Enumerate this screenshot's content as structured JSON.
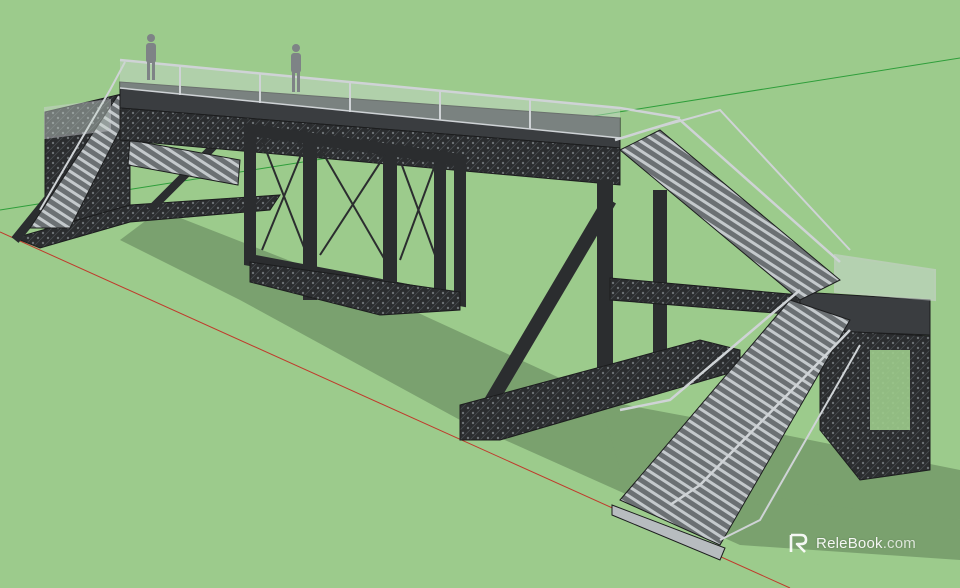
{
  "watermark": {
    "brand": "ReleBook",
    "suffix": ".com"
  },
  "colors": {
    "ground": "#9ccb8c",
    "steel": "#2b2d2f",
    "rail": "#cfd3d6",
    "glass": "#c9d6ce",
    "axis_red": "#c0392b",
    "axis_green": "#2e9e3a"
  }
}
